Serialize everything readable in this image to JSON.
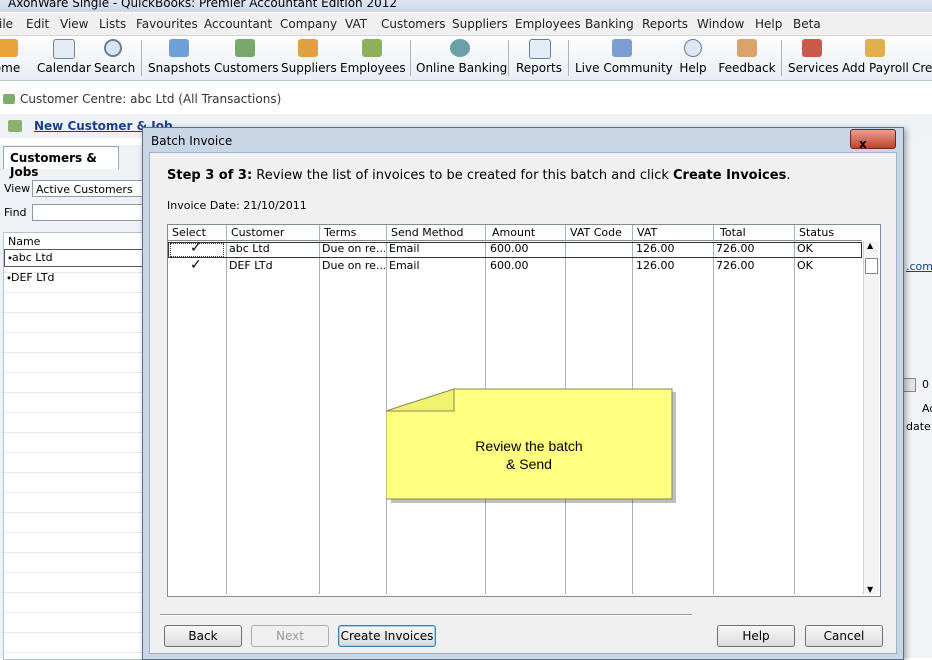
{
  "window": {
    "title": "AxonWare Single  - QuickBooks: Premier Accountant Edition 2012"
  },
  "menu": [
    "ile",
    "Edit",
    "View",
    "Lists",
    "Favourites",
    "Accountant",
    "Company",
    "VAT",
    "Customers",
    "Suppliers",
    "Employees",
    "Banking",
    "Reports",
    "Window",
    "Help",
    "Beta"
  ],
  "toolbar": {
    "items": [
      "ome",
      "Calendar",
      "Search",
      "Snapshots",
      "Customers",
      "Suppliers",
      "Employees",
      "Online Banking",
      "Reports",
      "Live Community",
      "Help",
      "Feedback",
      "Services",
      "Add Payroll",
      "Cre"
    ]
  },
  "customer_centre": {
    "header": "Customer Centre: abc Ltd (All Transactions)",
    "new_customer": "New Customer & Job",
    "tab": "Customers & Jobs",
    "view_label": "View",
    "view_value": "Active Customers",
    "find_label": "Find",
    "find_value": "",
    "name_header": "Name",
    "names": [
      "abc Ltd",
      "DEF LTd"
    ],
    "right_fragments": [
      ".com",
      "Ad",
      "date",
      "0"
    ]
  },
  "dialog": {
    "title": "Batch Invoice",
    "close": "x",
    "step_bold": "Step 3 of 3:",
    "step_text": " Review the list of invoices to be created for this batch and click ",
    "step_action": "Create Invoices",
    "step_end": ".",
    "invoice_date": "Invoice Date: 21/10/2011",
    "columns": [
      "Select",
      "Customer",
      "Terms",
      "Send Method",
      "Amount",
      "VAT Code",
      "VAT",
      "Total",
      "Status"
    ],
    "rows": [
      {
        "select": "✓",
        "customer": "abc Ltd",
        "terms": "Due on re...",
        "send": "Email",
        "amount": "600.00",
        "vat_code": "",
        "vat": "126.00",
        "total": "726.00",
        "status": "OK"
      },
      {
        "select": "✓",
        "customer": "DEF LTd",
        "terms": "Due on re...",
        "send": "Email",
        "amount": "600.00",
        "vat_code": "",
        "vat": "126.00",
        "total": "726.00",
        "status": "OK"
      }
    ],
    "note": {
      "line1": "Review the batch",
      "line2": "& Send",
      "color": "#ffff80"
    },
    "buttons": {
      "back": "Back",
      "next": "Next",
      "create": "Create Invoices",
      "help": "Help",
      "cancel": "Cancel"
    }
  }
}
